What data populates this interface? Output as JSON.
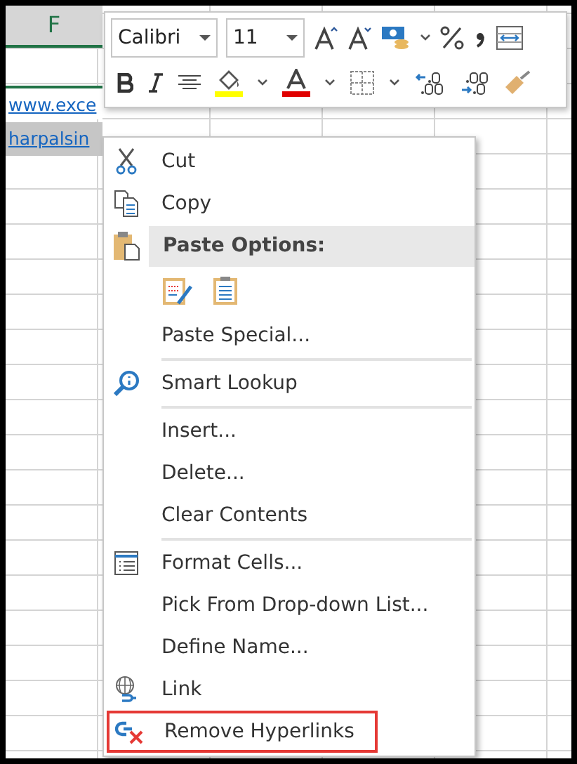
{
  "sheet": {
    "column_header": "F",
    "cells": [
      {
        "text": "www.exce",
        "kind": "link",
        "selected": false
      },
      {
        "text": "harpalsin",
        "kind": "link",
        "selected": true
      }
    ]
  },
  "mini_toolbar": {
    "font": "Calibri",
    "size": "11"
  },
  "context_menu": [
    {
      "kind": "item",
      "label": "Cut"
    },
    {
      "kind": "item",
      "label": "Copy"
    },
    {
      "kind": "header",
      "label": "Paste Options:"
    },
    {
      "kind": "paste-icons"
    },
    {
      "kind": "item",
      "label": "Paste Special..."
    },
    {
      "kind": "separator"
    },
    {
      "kind": "item",
      "label": "Smart Lookup"
    },
    {
      "kind": "separator"
    },
    {
      "kind": "item",
      "label": "Insert..."
    },
    {
      "kind": "item",
      "label": "Delete..."
    },
    {
      "kind": "item",
      "label": "Clear Contents"
    },
    {
      "kind": "separator"
    },
    {
      "kind": "item",
      "label": "Format Cells..."
    },
    {
      "kind": "item",
      "label": "Pick From Drop-down List..."
    },
    {
      "kind": "item",
      "label": "Define Name..."
    },
    {
      "kind": "item",
      "label": "Link"
    },
    {
      "kind": "item",
      "label": "Remove Hyperlinks",
      "highlighted": true
    }
  ]
}
